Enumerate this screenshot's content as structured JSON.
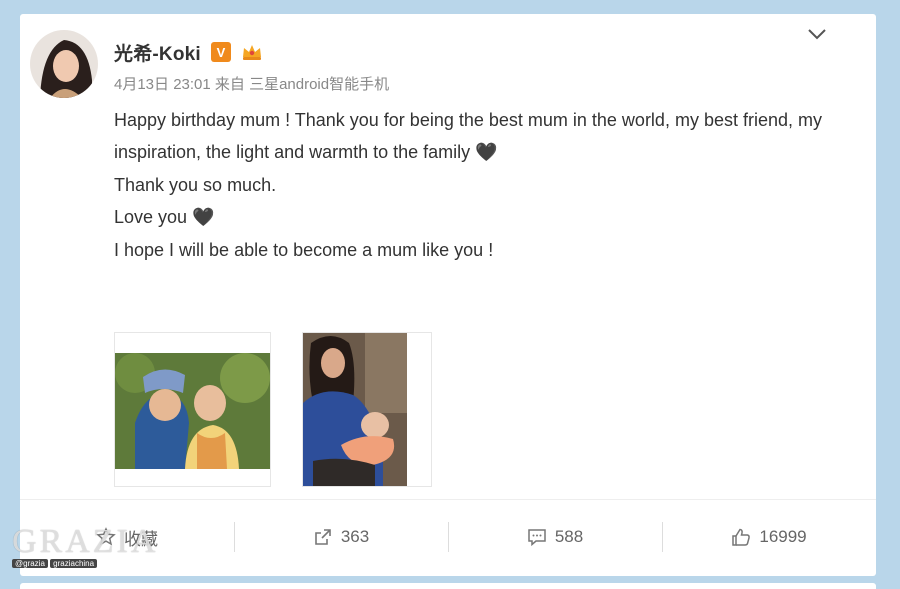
{
  "post": {
    "author": "光希-Koki",
    "verified_badge": "V",
    "meta": "4月13日 23:01 来自 三星android智能手机",
    "paragraphs": [
      "Happy birthday mum ! Thank you for being the best mum in the world, my best friend, my inspiration, the light and warmth to the family 🖤",
      "",
      "Thank you so much.",
      "Love you 🖤",
      "",
      "I hope I will be able to become a mum like you !"
    ]
  },
  "actions": {
    "favorite_label": "收藏",
    "repost_count": "363",
    "comment_count": "588",
    "like_count": "16999"
  },
  "watermark": {
    "logo": "GRAZIA",
    "handle_weibo": "@grazia",
    "handle_wechat": "graziachina"
  },
  "colors": {
    "page_bg": "#b9d6ea",
    "verified_orange": "#f08a1c",
    "text_main": "#333333",
    "text_meta": "#888888"
  },
  "icons": [
    "avatar",
    "verified-badge",
    "member-crown-icon",
    "chevron-down-icon",
    "star-icon",
    "repost-icon",
    "comment-icon",
    "thumbs-up-icon"
  ]
}
